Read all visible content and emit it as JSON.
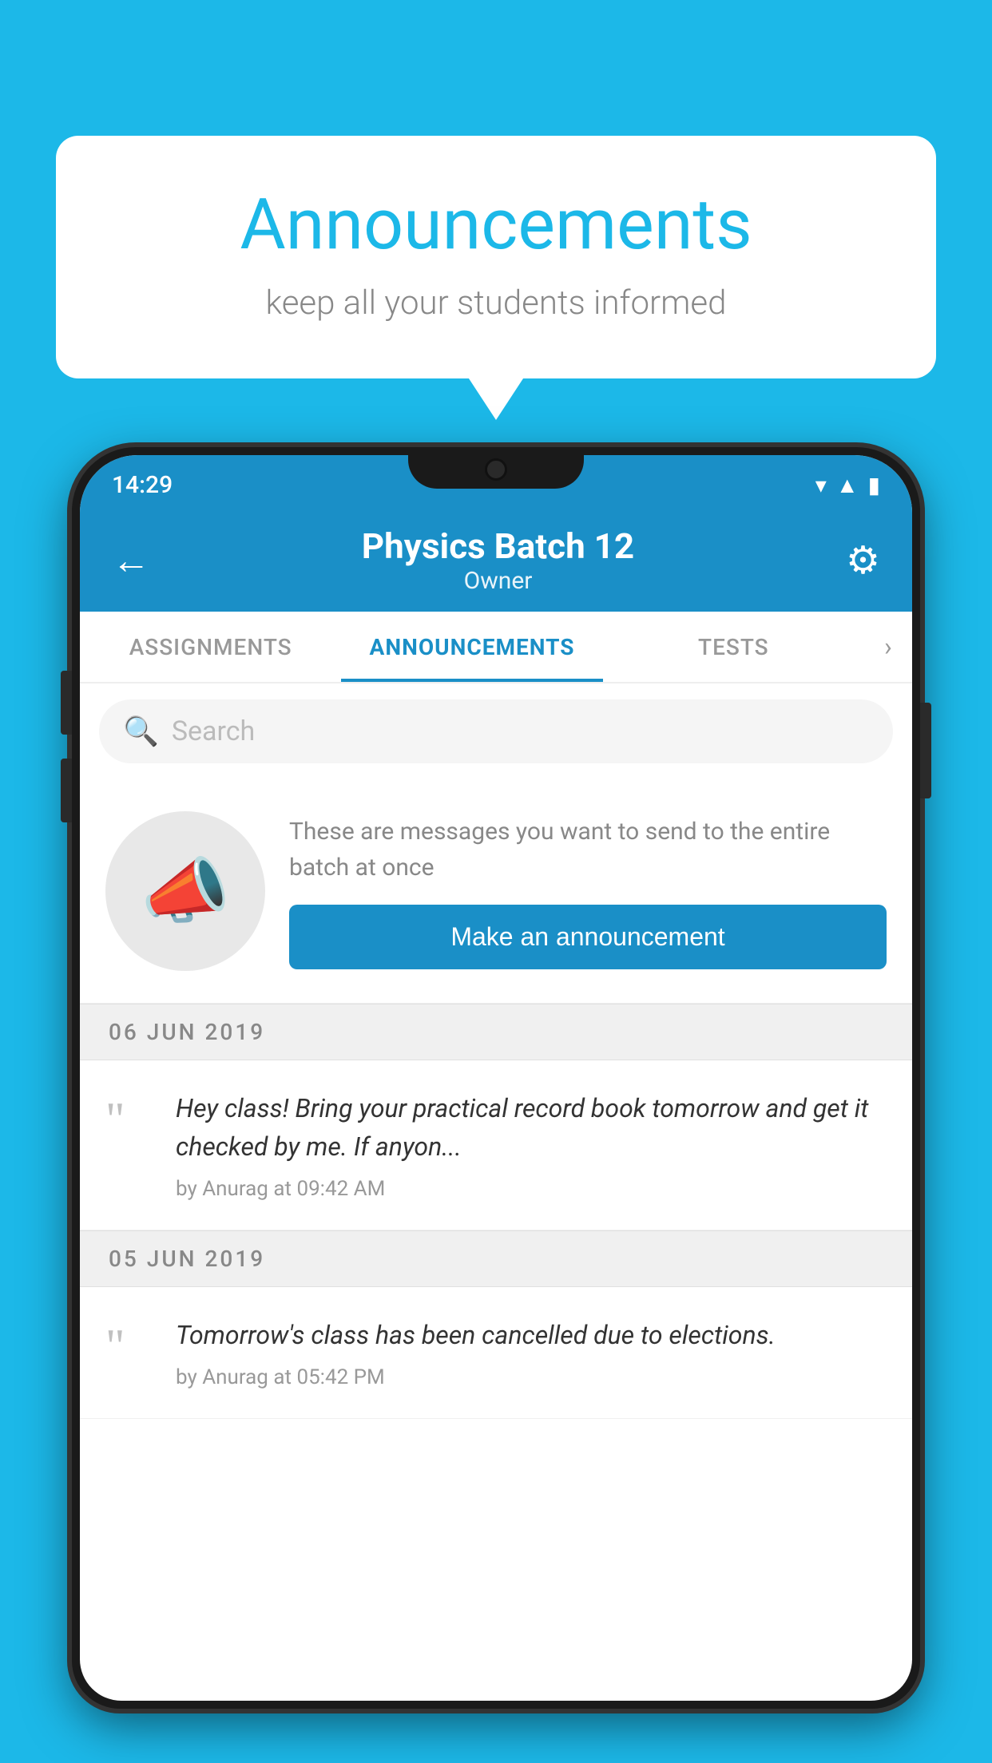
{
  "page": {
    "background_color": "#1cb8e8"
  },
  "speech_bubble": {
    "title": "Announcements",
    "subtitle": "keep all your students informed",
    "title_color": "#1cb8e8"
  },
  "status_bar": {
    "time": "14:29"
  },
  "header": {
    "title": "Physics Batch 12",
    "subtitle": "Owner",
    "back_label": "←",
    "settings_label": "⚙"
  },
  "tabs": [
    {
      "label": "ASSIGNMENTS",
      "active": false
    },
    {
      "label": "ANNOUNCEMENTS",
      "active": true
    },
    {
      "label": "TESTS",
      "active": false
    }
  ],
  "search": {
    "placeholder": "Search"
  },
  "announcement_prompt": {
    "description_text": "These are messages you want to send to the entire batch at once",
    "button_label": "Make an announcement"
  },
  "announcements": [
    {
      "date": "06  JUN  2019",
      "text": "Hey class! Bring your practical record book tomorrow and get it checked by me. If anyon...",
      "meta": "by Anurag at 09:42 AM"
    },
    {
      "date": "05  JUN  2019",
      "text": "Tomorrow's class has been cancelled due to elections.",
      "meta": "by Anurag at 05:42 PM"
    }
  ]
}
